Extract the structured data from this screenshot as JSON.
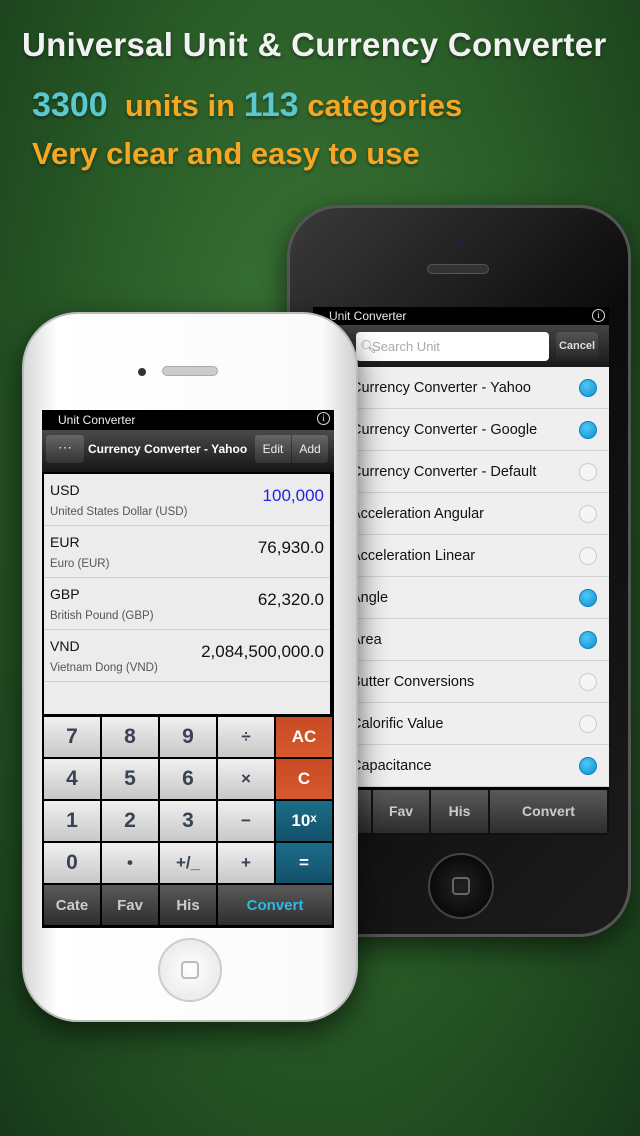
{
  "headline": {
    "title": "Universal Unit & Currency Converter",
    "units_count": "3300",
    "units_text": "units in",
    "categories_count": "113",
    "categories_text": "categories",
    "tagline": "Very clear and easy to use"
  },
  "back_phone": {
    "status_title": "Unit Converter",
    "search_placeholder": "Search Unit",
    "cancel_label": "Cancel",
    "items": [
      {
        "label": "Currency Converter - Yahoo",
        "selected": true
      },
      {
        "label": "Currency Converter - Google",
        "selected": true
      },
      {
        "label": "Currency Converter - Default",
        "selected": false
      },
      {
        "label": "Acceleration Angular",
        "selected": false
      },
      {
        "label": "Acceleration Linear",
        "selected": false
      },
      {
        "label": "Angle",
        "selected": true
      },
      {
        "label": "Area",
        "selected": true
      },
      {
        "label": "Butter Conversions",
        "selected": false
      },
      {
        "label": "Calorific Value",
        "selected": false
      },
      {
        "label": "Capacitance",
        "selected": true
      }
    ],
    "tabs": [
      "Fav",
      "His",
      "Convert"
    ]
  },
  "front_phone": {
    "status_title": "Unit Converter",
    "toolbar_title": "Currency Converter - Yahoo",
    "edit_label": "Edit",
    "add_label": "Add",
    "rows": [
      {
        "code": "USD",
        "name": "United States Dollar (USD)",
        "value": "100,000"
      },
      {
        "code": "EUR",
        "name": "Euro (EUR)",
        "value": "76,930.0"
      },
      {
        "code": "GBP",
        "name": "British Pound (GBP)",
        "value": "62,320.0"
      },
      {
        "code": "VND",
        "name": "Vietnam Dong (VND)",
        "value": "2,084,500,000.0"
      }
    ],
    "keys": [
      "7",
      "8",
      "9",
      "÷",
      "AC",
      "4",
      "5",
      "6",
      "×",
      "C",
      "1",
      "2",
      "3",
      "−",
      "10ˣ",
      "0",
      "•",
      "+/_",
      "+",
      "="
    ],
    "tabs": [
      "Cate",
      "Fav",
      "His",
      "Convert"
    ]
  },
  "colors": {
    "accent_orange": "#f5a623",
    "accent_teal": "#5bc8d0",
    "selected_dot": "#1a9ee0",
    "input_value": "#2323d8"
  }
}
